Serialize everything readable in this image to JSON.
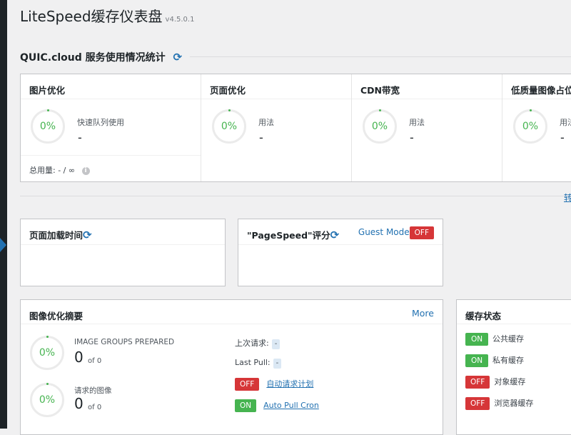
{
  "header": {
    "title": "LiteSpeed缓存仪表盘",
    "version": "v4.5.0.1"
  },
  "quic": {
    "section_title": "QUIC.cloud 服务使用情况统计",
    "refresh_icon": "⟳",
    "columns": [
      {
        "title": "图片优化",
        "percent": "0%",
        "label": "快速队列使用",
        "value": "-"
      },
      {
        "title": "页面优化",
        "percent": "0%",
        "label": "用法",
        "value": "-"
      },
      {
        "title": "CDN带宽",
        "percent": "0%",
        "label": "用法",
        "value": "-"
      },
      {
        "title": "低质量图像占位",
        "percent": "0%",
        "label": "用法",
        "value": "-"
      }
    ],
    "total_label": "总用量:",
    "total_value": "- / ∞",
    "info_icon": "i"
  },
  "right_link": "转",
  "page_load": {
    "title": "页面加载时间",
    "refresh_icon": "⟳"
  },
  "pagespeed": {
    "title": "\"PageSpeed\"评分",
    "refresh_icon": "⟳",
    "guest_label": "Guest Mode",
    "guest_state": "OFF"
  },
  "image_summary": {
    "title": "图像优化摘要",
    "more": "More",
    "groups": {
      "percent": "0%",
      "label": "IMAGE GROUPS PREPARED",
      "count": "0",
      "of": "of 0"
    },
    "requested": {
      "percent": "0%",
      "label": "请求的图像",
      "count": "0",
      "of": "of 0"
    },
    "last_request_label": "上次请求:",
    "last_request_value": "-",
    "last_pull_label": "Last Pull:",
    "last_pull_value": "-",
    "auto_request": {
      "state": "OFF",
      "label": "自动请求计划"
    },
    "auto_pull": {
      "state": "ON",
      "label": "Auto Pull Cron"
    }
  },
  "cache_status": {
    "title": "缓存状态",
    "items": [
      {
        "state": "ON",
        "label": "公共缓存"
      },
      {
        "state": "ON",
        "label": "私有缓存"
      },
      {
        "state": "OFF",
        "label": "对象缓存"
      },
      {
        "state": "OFF",
        "label": "浏览器缓存"
      }
    ]
  },
  "colors": {
    "accent": "#2271b1",
    "on": "#46b450",
    "off": "#d63638"
  }
}
